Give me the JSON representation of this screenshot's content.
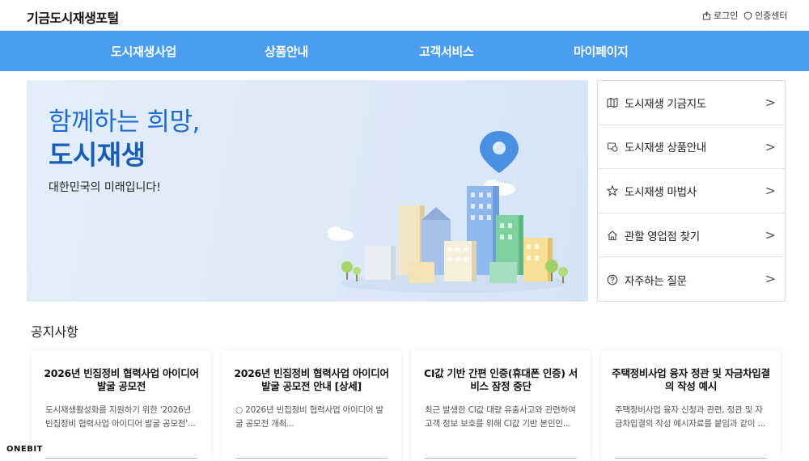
{
  "header": {
    "site_title": "기금도시재생포털",
    "login_label": "로그인",
    "cert_label": "인증센터"
  },
  "gnb": {
    "items": [
      "도시재생사업",
      "상품안내",
      "고객서비스",
      "마이페이지"
    ]
  },
  "hero": {
    "line1": "함께하는 희망,",
    "line2": "도시재생",
    "sub": "대한민국의 미래입니다!"
  },
  "quick_links": [
    {
      "label": "도시재생 기금지도",
      "icon": "map-icon"
    },
    {
      "label": "도시재생 상품안내",
      "icon": "product-icon"
    },
    {
      "label": "도시재생 마법사",
      "icon": "wand-star-icon"
    },
    {
      "label": "관할 영업점 찾기",
      "icon": "home-icon"
    },
    {
      "label": "자주하는 질문",
      "icon": "question-icon"
    }
  ],
  "notice": {
    "title": "공지사항",
    "cards": [
      {
        "title": "2026년 빈집정비 협력사업 아이디어 발굴 공모전",
        "desc": "도시재생활성화를 지원하기 위한 '2026년 빈집정비 협력사업 아이디어 발굴 공모전'..."
      },
      {
        "title": "2026년 빈집정비 협력사업 아이디어 발굴 공모전 안내 [상세]",
        "desc": "○ 2026년 빈집정비 협력사업 아이디어 발굴 공모전 개최..."
      },
      {
        "title": "CI값 기반 간편 인증(휴대폰 인증) 서비스 잠정 중단",
        "desc": "최근 발생한 CI값 대량 유출사고와 관련하여 고객 정보 보호를 위해 CI값 기반 본인인..."
      },
      {
        "title": "주택정비사업 융자 정관 및 자금차입결의 작성 예시",
        "desc": "주택정비사업 융자 신청과 관련, 정관 및 자금차입결의 작성 예시자료를 붙임과 같이 ..."
      }
    ]
  },
  "footer": {
    "brand": "ONEBIT"
  },
  "colors": {
    "nav_bg": "#4a9df0",
    "hero_title": "#1d6bd0"
  }
}
